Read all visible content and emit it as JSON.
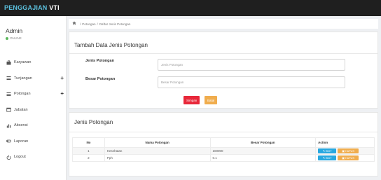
{
  "app": {
    "brand_main": "PENGGAJIAN",
    "brand_highlight": " VTI"
  },
  "user": {
    "name": "Admin",
    "status": "ONLINE"
  },
  "sidebar": {
    "items": [
      {
        "label": "Karyawan",
        "icon": "briefcase-icon",
        "expandable": false
      },
      {
        "label": "Tunjangan",
        "icon": "list-icon",
        "expandable": true
      },
      {
        "label": "Potongan",
        "icon": "list-icon",
        "expandable": true
      },
      {
        "label": "Jabatan",
        "icon": "calendar-icon",
        "expandable": false
      },
      {
        "label": "Absensi",
        "icon": "bar-chart-icon",
        "expandable": false
      },
      {
        "label": "Laporan",
        "icon": "toggle-icon",
        "expandable": false
      },
      {
        "label": "Logout",
        "icon": "power-icon",
        "expandable": false
      }
    ],
    "expand_symbol": "+"
  },
  "breadcrumb": {
    "items": [
      "Potongan",
      "Daftar Jenis Potongan"
    ],
    "separator": "/"
  },
  "form_panel": {
    "title": "Tambah Data Jenis Potongan",
    "fields": {
      "jenis": {
        "label": "Jenis Potongan",
        "placeholder": "Jenis Potongan",
        "value": ""
      },
      "besar": {
        "label": "Besar Potongan",
        "placeholder": "Besar Potongan",
        "value": ""
      }
    },
    "save_label": "Simpan",
    "reset_label": "Batal"
  },
  "table_panel": {
    "title": "Jenis Potongan",
    "columns": [
      "No",
      "Nama Potongan",
      "Besar Potongan",
      "Action"
    ],
    "rows": [
      {
        "no": "1",
        "nama": "Kesehatan",
        "besar": "100000"
      },
      {
        "no": "2",
        "nama": "Pph",
        "besar": "0.1"
      }
    ],
    "edit_label": "EDIT",
    "delete_label": "HAPUS"
  },
  "colors": {
    "topbar": "#1f1f1f",
    "brand": "#5bc0de",
    "save": "#e8283a",
    "reset": "#f0ad4e",
    "edit": "#28a8e0",
    "delete": "#f0ad4e",
    "online": "#5cb85c"
  }
}
